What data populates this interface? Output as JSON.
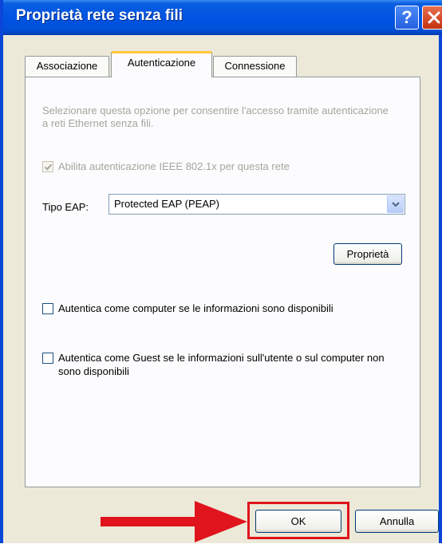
{
  "window": {
    "title": "Proprietà rete senza fili",
    "help_label": "?"
  },
  "tabs": [
    {
      "label": "Associazione",
      "active": false
    },
    {
      "label": "Autenticazione",
      "active": true
    },
    {
      "label": "Connessione",
      "active": false
    }
  ],
  "auth": {
    "description": "Selezionare questa opzione per consentire l'accesso tramite autenticazione a reti Ethernet senza fili.",
    "enable_8021x": {
      "label": "Abilita autenticazione IEEE 802.1x per questa rete",
      "checked": true,
      "enabled": false
    },
    "eap_type_label": "Tipo EAP:",
    "eap_type_value": "Protected EAP (PEAP)",
    "properties_button": "Proprietà",
    "auth_as_computer": {
      "label": "Autentica come computer se le informazioni sono disponibili",
      "checked": false
    },
    "auth_as_guest": {
      "label": "Autentica come Guest se le informazioni sull'utente o sul computer non sono disponibili",
      "checked": false
    }
  },
  "footer": {
    "ok_label": "OK",
    "cancel_label": "Annulla"
  },
  "annotation": {
    "highlight_color": "#e0141c"
  }
}
